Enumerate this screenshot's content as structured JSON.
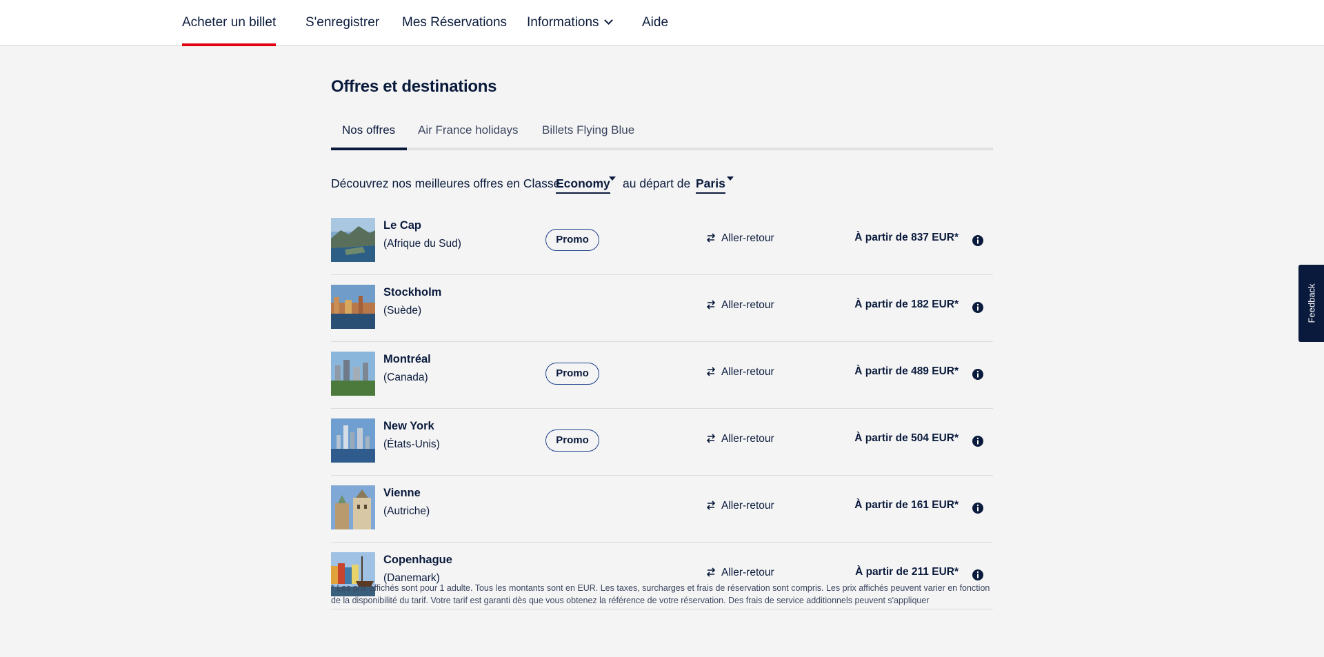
{
  "nav": {
    "items": [
      {
        "label": "Acheter un billet",
        "active": true
      },
      {
        "label": "S'enregistrer"
      },
      {
        "label": "Mes Réservations"
      },
      {
        "label": "Informations"
      },
      {
        "label": "Aide"
      }
    ]
  },
  "page": {
    "title": "Offres et destinations",
    "tabs": [
      {
        "label": "Nos offres",
        "active": true
      },
      {
        "label": "Air France holidays"
      },
      {
        "label": "Billets Flying Blue"
      }
    ],
    "filter": {
      "prefix": "Découvrez nos meilleures offres en Classe",
      "class_value": "Economy",
      "middle": "au départ de",
      "departure_value": "Paris"
    },
    "offers": [
      {
        "city": "Le Cap",
        "country": "(Afrique du Sud)",
        "promo": "Promo",
        "trip": "Aller-retour",
        "price": "À partir de 837 EUR*"
      },
      {
        "city": "Stockholm",
        "country": "(Suède)",
        "promo": "",
        "trip": "Aller-retour",
        "price": "À partir de 182 EUR*"
      },
      {
        "city": "Montréal",
        "country": "(Canada)",
        "promo": "Promo",
        "trip": "Aller-retour",
        "price": "À partir de 489 EUR*"
      },
      {
        "city": "New York",
        "country": "(États-Unis)",
        "promo": "Promo",
        "trip": "Aller-retour",
        "price": "À partir de 504 EUR*"
      },
      {
        "city": "Vienne",
        "country": "(Autriche)",
        "promo": "",
        "trip": "Aller-retour",
        "price": "À partir de 161 EUR*"
      },
      {
        "city": "Copenhague",
        "country": "(Danemark)",
        "promo": "",
        "trip": "Aller-retour",
        "price": "À partir de 211 EUR*"
      }
    ],
    "footnote": "* Les prix affichés sont pour 1 adulte. Tous les montants sont en EUR. Les taxes, surcharges et frais de réservation sont compris. Les prix affichés peuvent varier en fonction de la disponibilité du tarif. Votre tarif est garanti dès que vous obtenez la référence de votre réservation. Des frais de service additionnels peuvent s'appliquer"
  },
  "feedback": {
    "label": "Feedback"
  },
  "colors": {
    "navy": "#0a1a3c",
    "accent_red": "#e1000f",
    "background": "#f4f4f4"
  }
}
